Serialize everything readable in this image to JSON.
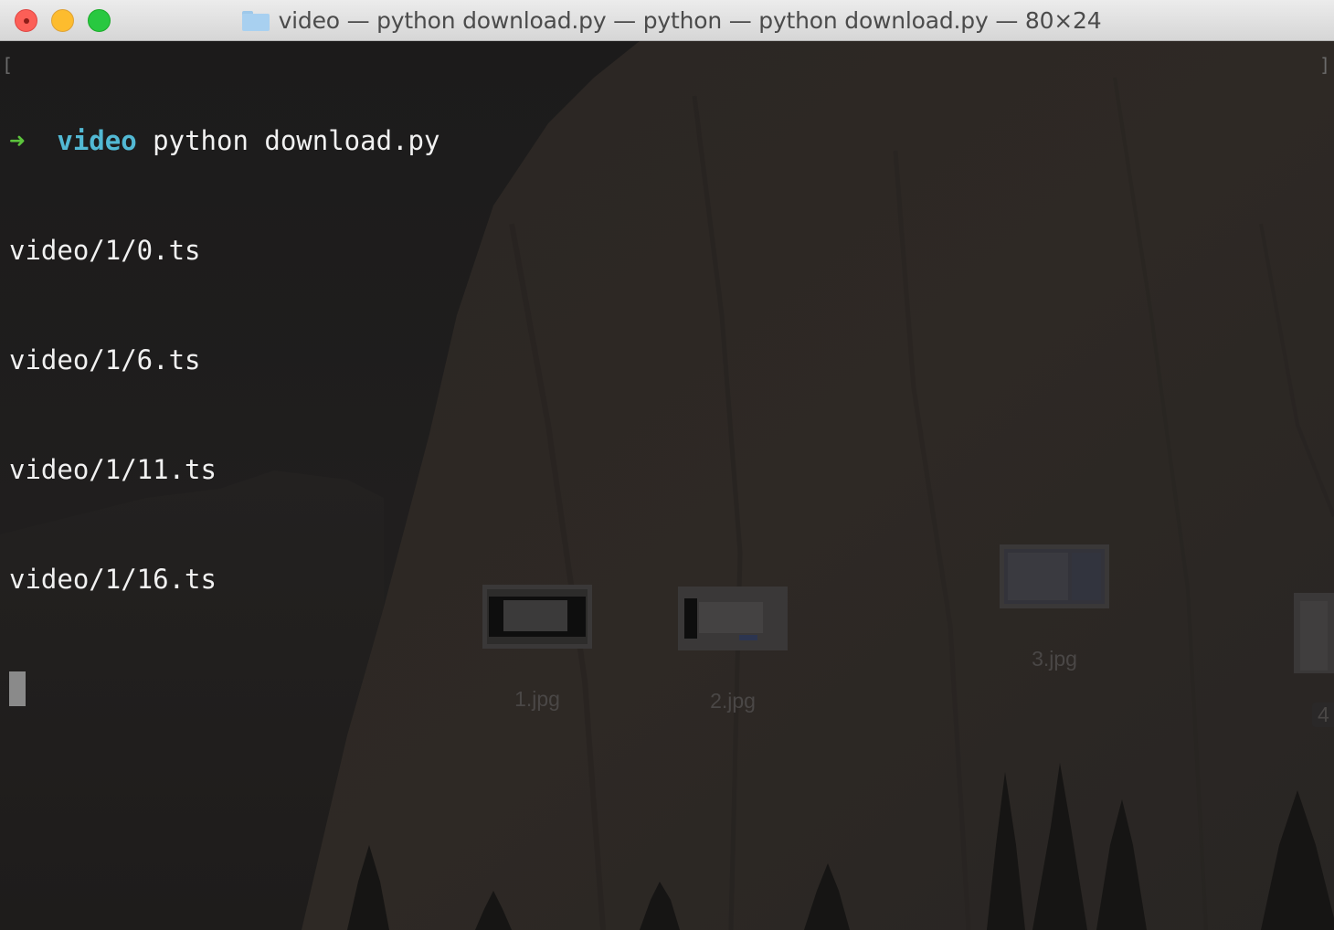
{
  "window": {
    "title": "video — python download.py — python — python download.py — 80×24"
  },
  "terminal": {
    "prompt_arrow": "➜",
    "prompt_dir": "video",
    "command": "python download.py",
    "output_lines": [
      "video/1/0.ts",
      "video/1/6.ts",
      "video/1/11.ts",
      "video/1/16.ts"
    ]
  },
  "desktop": {
    "icons": [
      {
        "label": "1.jpg"
      },
      {
        "label": "2.jpg"
      },
      {
        "label": "3.jpg"
      },
      {
        "label": "4"
      }
    ]
  },
  "colors": {
    "close": "#fc5f57",
    "minimize": "#fdbc2e",
    "maximize": "#28c840",
    "prompt_arrow": "#5cc43c",
    "prompt_dir": "#52b9d4",
    "terminal_text": "#f1f1f1"
  }
}
